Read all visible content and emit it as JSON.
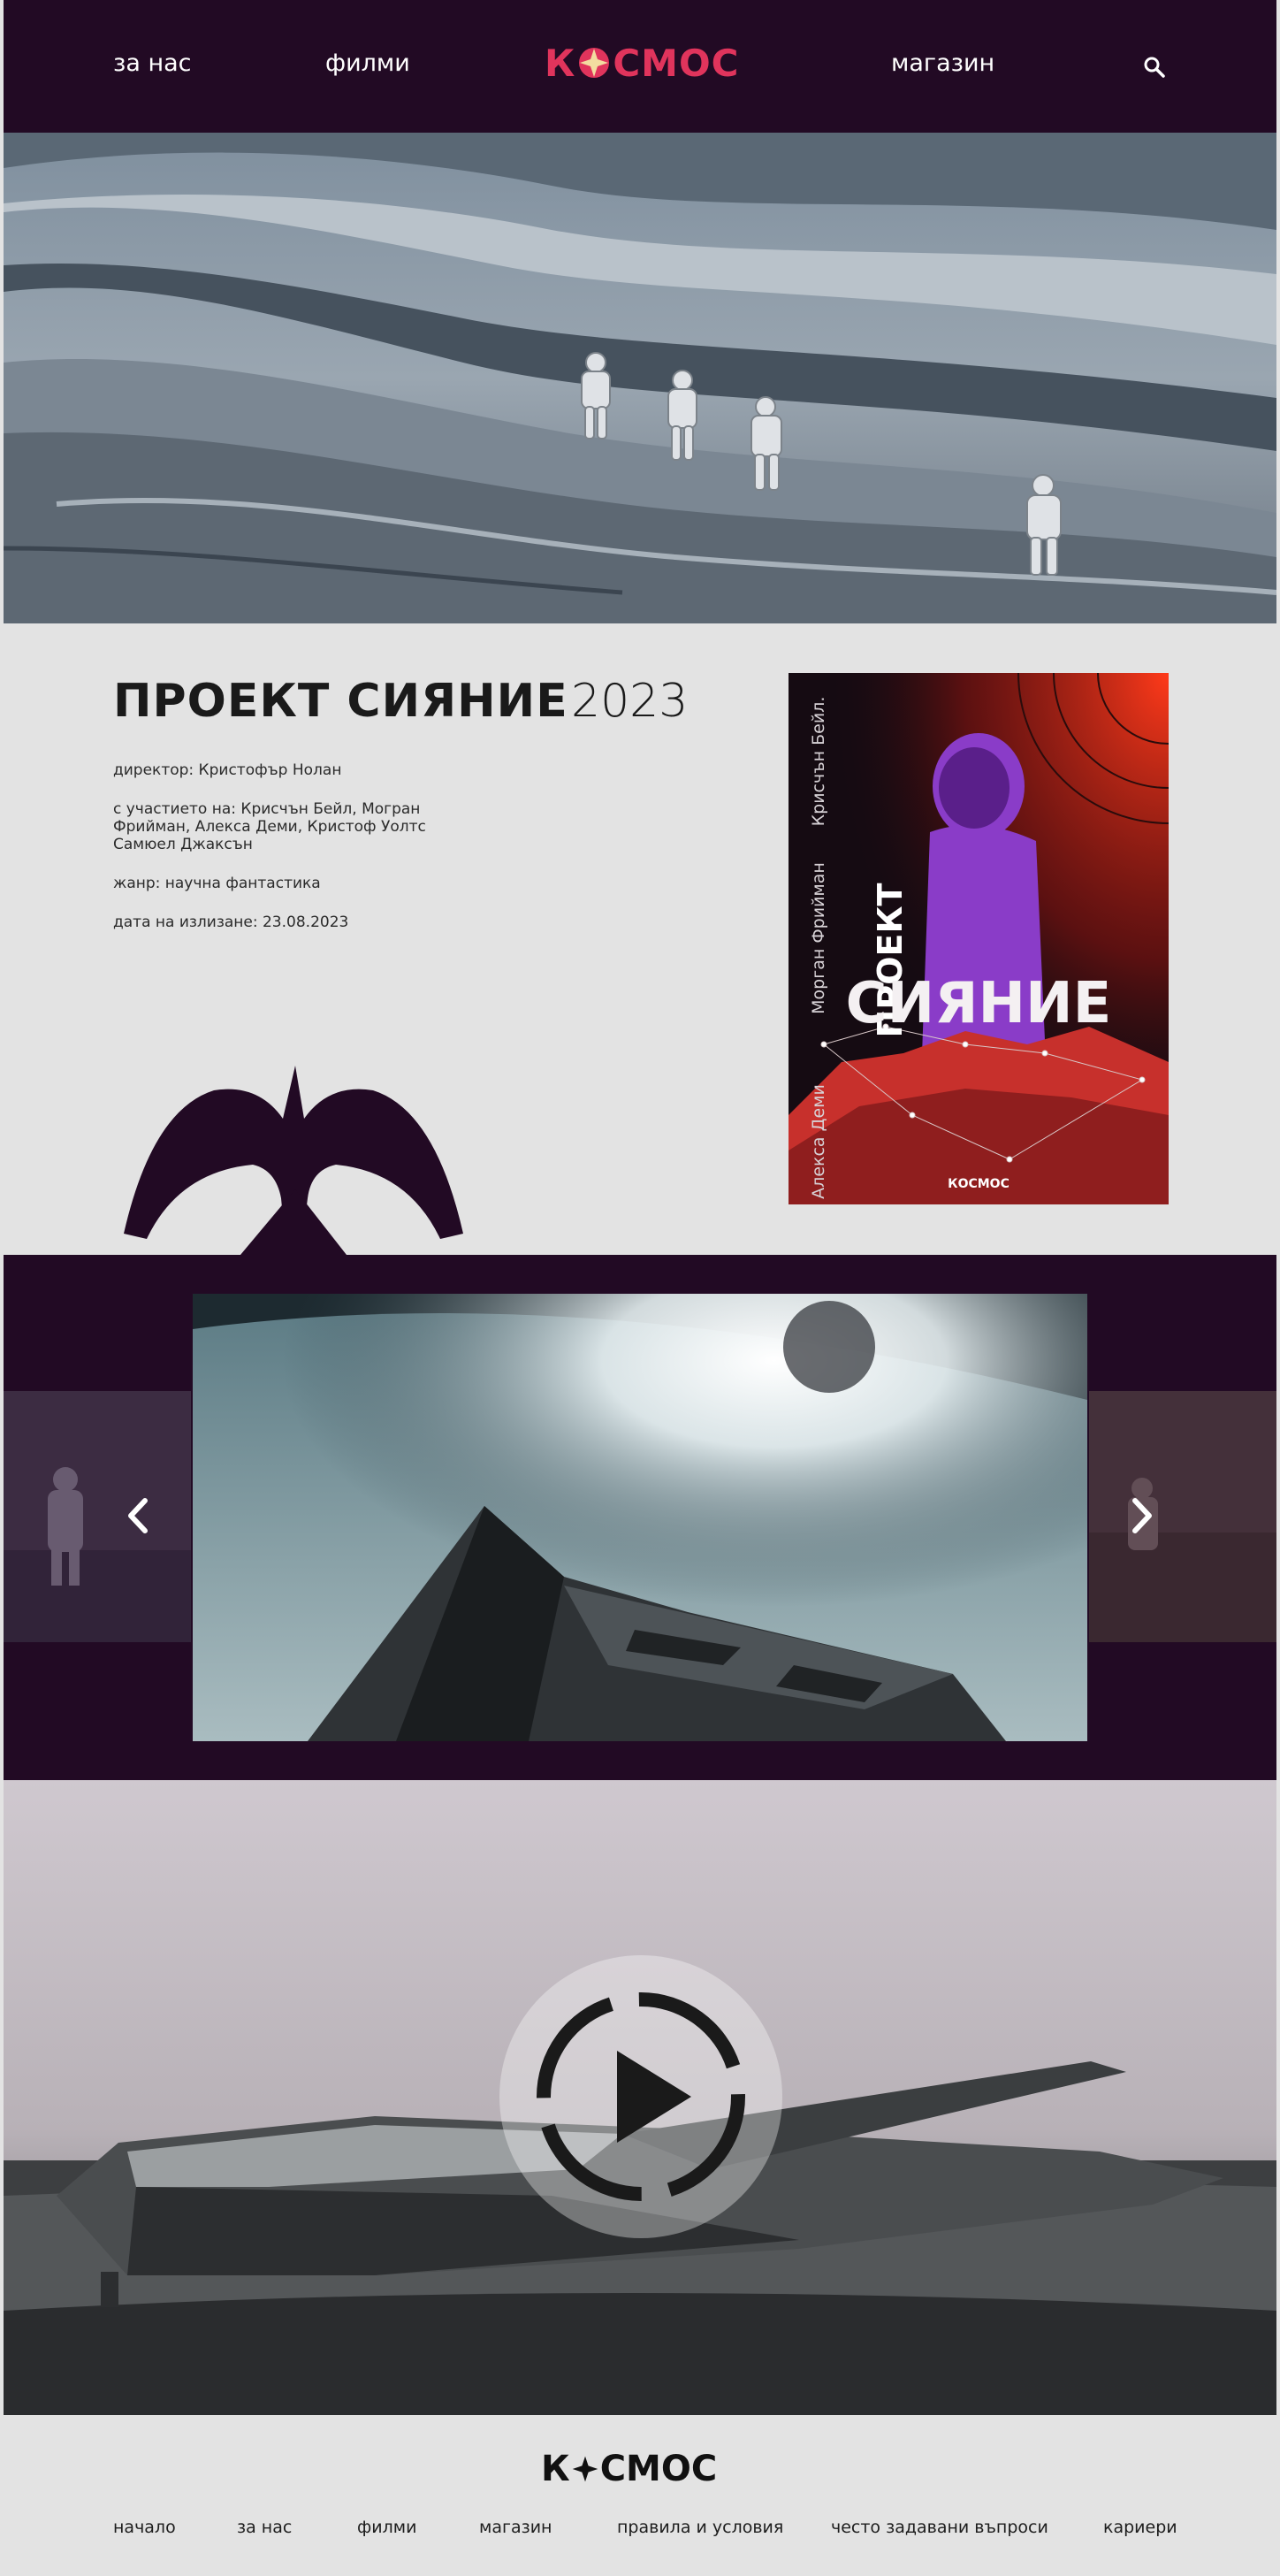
{
  "header": {
    "nav_about": "за нас",
    "nav_films": "филми",
    "nav_shop": "магазин",
    "logo_text_left": "К",
    "logo_text_right": "СМОС",
    "search_icon": "search-icon"
  },
  "colors": {
    "brand_dark": "#220a24",
    "accent_pink": "#e0345c",
    "accent_gold": "#f3dca0",
    "background": "#e3e3e3"
  },
  "movie": {
    "title": "ПРОЕКТ СИЯНИЕ",
    "year": "2023",
    "director": "директор: Кристофър Нолан",
    "cast": "с участието на: Крисчън Бейл, Могран Фрийман, Алекса Деми, Кристоф Уолтс Самюел Джаксън",
    "genre": "жанр: научна фантастика",
    "release": "дата на излизане: 23.08.2023"
  },
  "poster": {
    "actor_top": "Крисчън Бейл.",
    "actor_middle": "Морган Фрийман",
    "actor_bottom": "Алекса Деми",
    "title_top": "ПРОЕКТ",
    "title_main": "СИЯНИЕ",
    "logo": "КОСМОС"
  },
  "gallery": {
    "prev_icon": "chevron-left-icon",
    "next_icon": "chevron-right-icon"
  },
  "video": {
    "play_icon": "play-icon"
  },
  "footer": {
    "logo_left": "К",
    "logo_right": "СМОС",
    "links": [
      "начало",
      "за нас",
      "филми",
      "магазин",
      "правила и условия",
      "често задавани въпроси",
      "кариери"
    ]
  }
}
